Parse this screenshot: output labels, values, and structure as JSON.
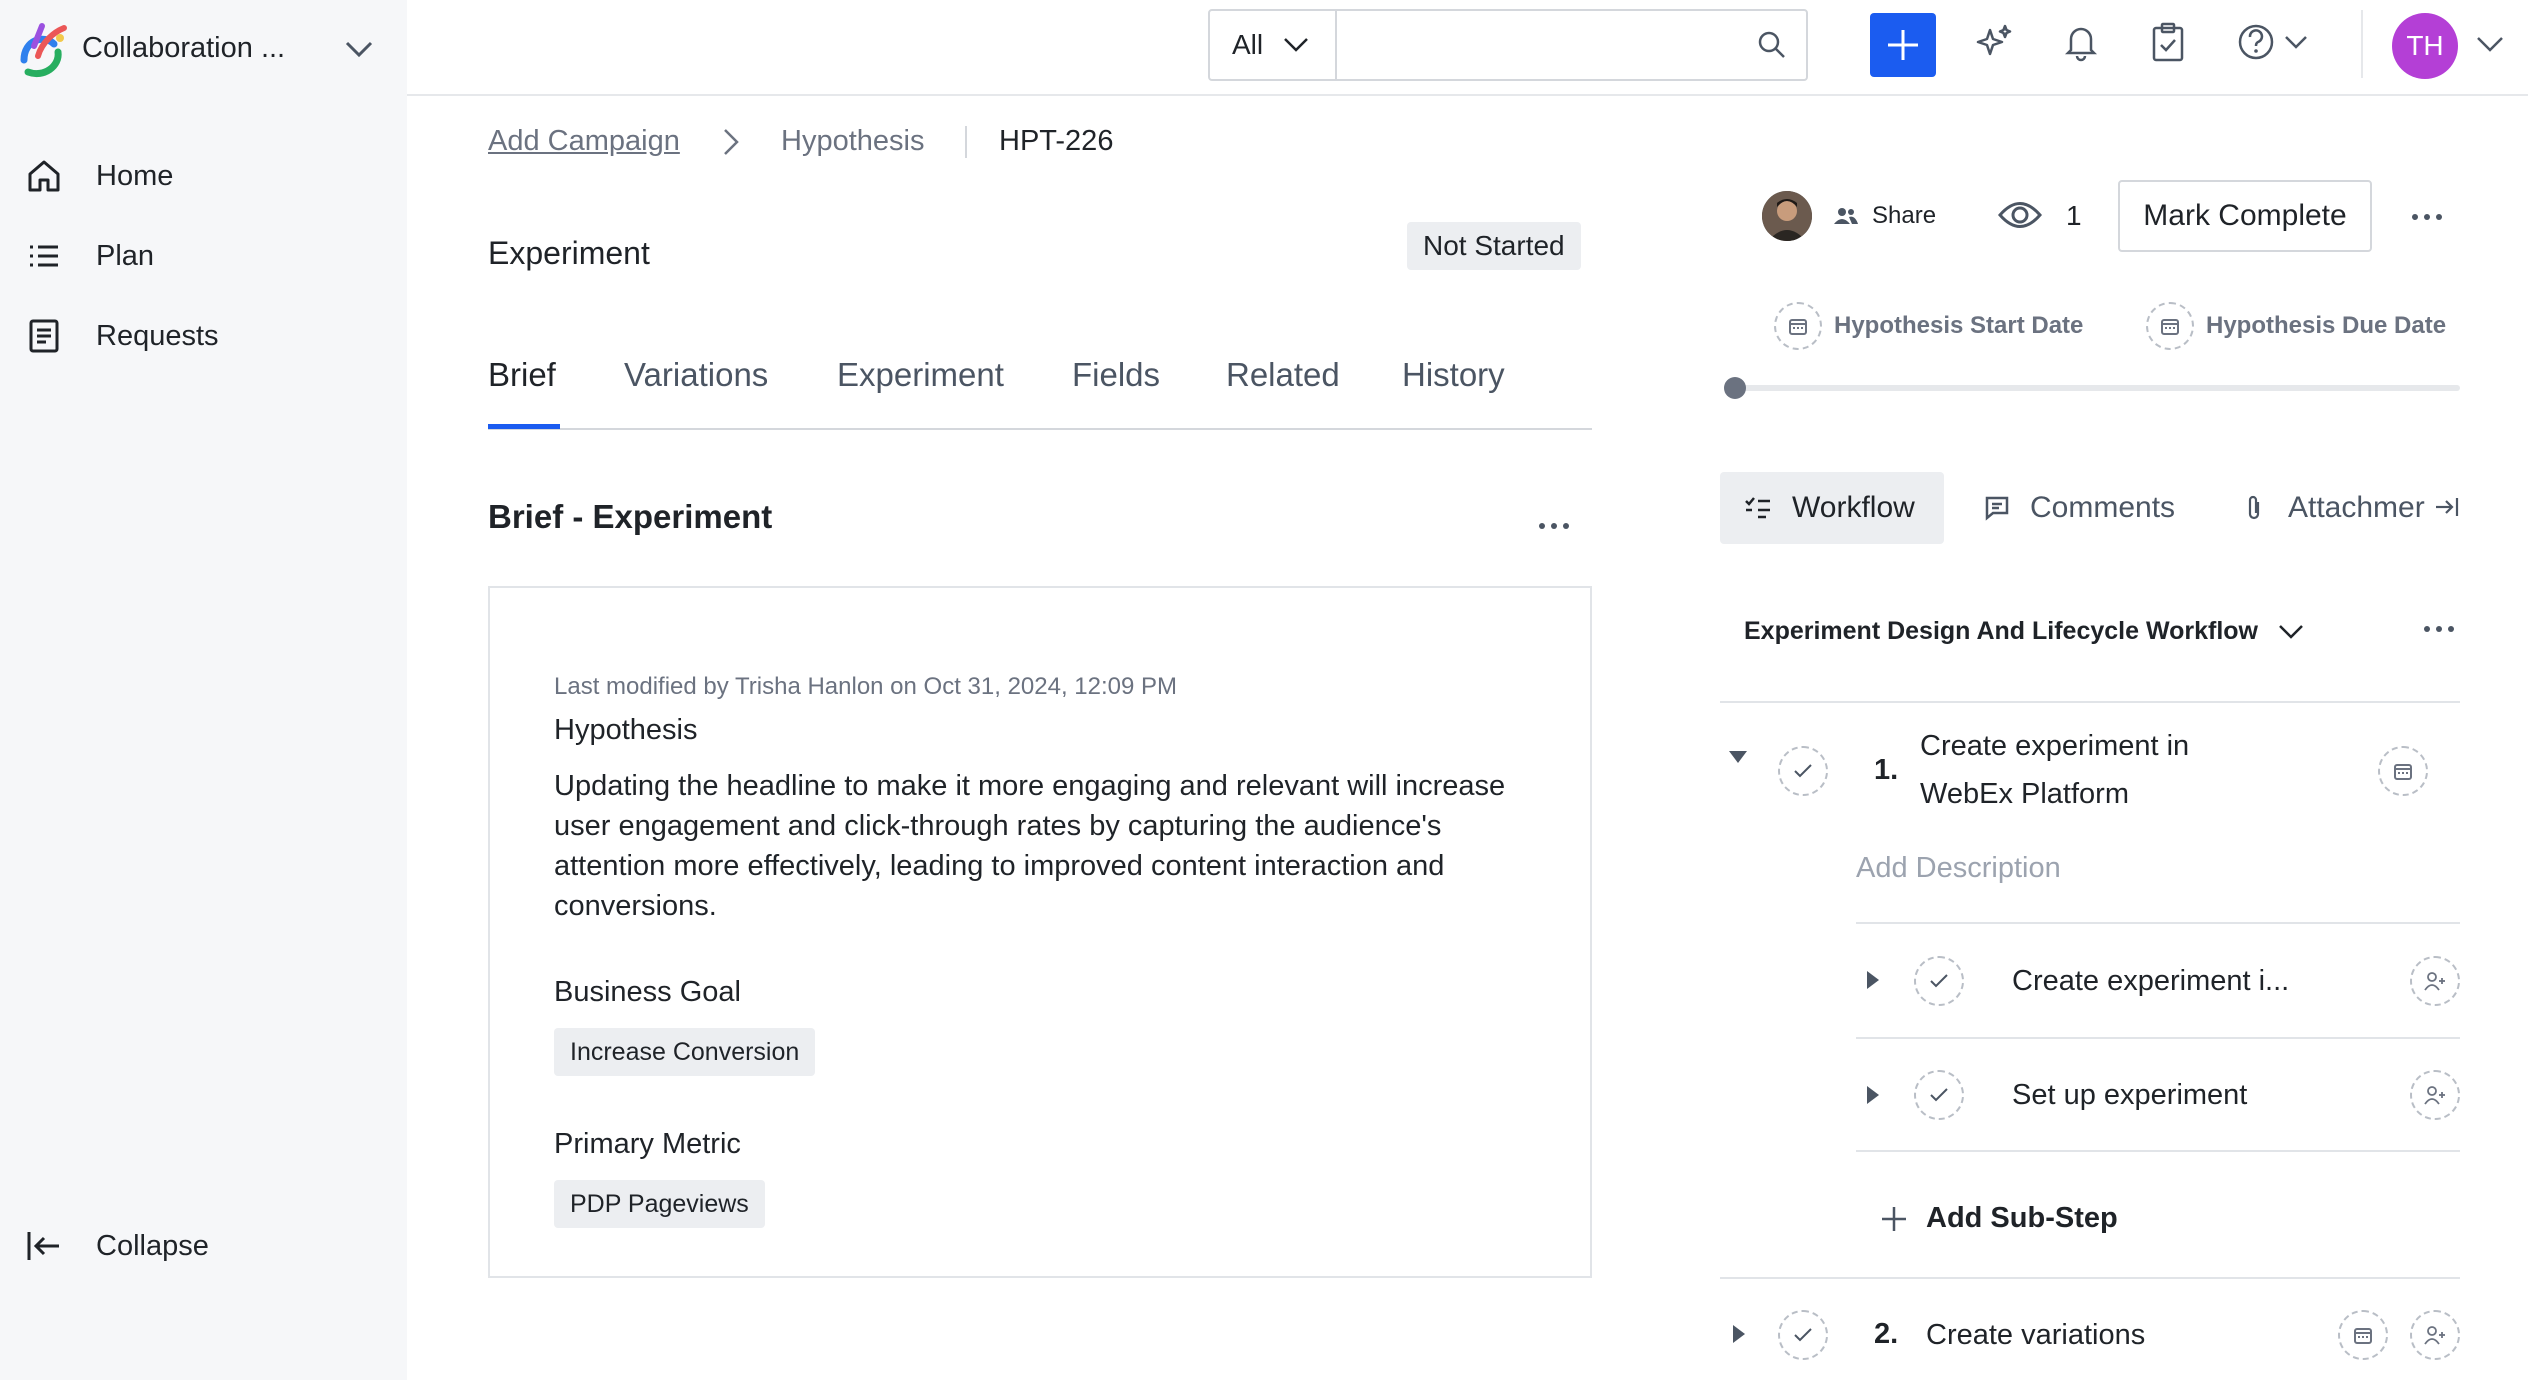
{
  "sidebar": {
    "workspace_name": "Collaboration ...",
    "items": [
      {
        "label": "Home",
        "icon": "home-icon"
      },
      {
        "label": "Plan",
        "icon": "list-icon"
      },
      {
        "label": "Requests",
        "icon": "document-icon"
      }
    ],
    "collapse_label": "Collapse"
  },
  "topbar": {
    "search_scope": "All",
    "search_placeholder": "",
    "user_initials": "TH",
    "accent_color": "#1b5cf0",
    "avatar_color": "#b43fd6"
  },
  "breadcrumb": {
    "parent": "Add Campaign",
    "type": "Hypothesis",
    "id": "HPT-226"
  },
  "main": {
    "title": "Experiment",
    "status": "Not Started",
    "tabs": [
      "Brief",
      "Variations",
      "Experiment",
      "Fields",
      "Related",
      "History"
    ],
    "active_tab": "Brief",
    "section_title": "Brief - Experiment",
    "card": {
      "last_modified": "Last modified by Trisha Hanlon on Oct 31, 2024, 12:09 PM",
      "hypothesis_label": "Hypothesis",
      "hypothesis_text": "Updating the headline to make it more engaging and relevant will increase user engagement and click-through rates by capturing the audience's attention more effectively, leading to improved content interaction and conversions.",
      "business_goal_label": "Business Goal",
      "business_goal_value": "Increase Conversion",
      "primary_metric_label": "Primary Metric",
      "primary_metric_value": "PDP Pageviews"
    }
  },
  "right_panel": {
    "share_label": "Share",
    "watchers_count": "1",
    "mark_complete_label": "Mark Complete",
    "start_date_label": "Hypothesis Start Date",
    "due_date_label": "Hypothesis Due Date",
    "tabs": [
      "Workflow",
      "Comments",
      "Attachmer"
    ],
    "workflow_name": "Experiment Design And Lifecycle Workflow",
    "steps": [
      {
        "number": "1.",
        "title_line1": "Create experiment in",
        "title_line2": "WebEx Platform",
        "description_placeholder": "Add Description",
        "sub_steps": [
          "Create experiment i...",
          "Set up experiment"
        ],
        "add_sub_step_label": "Add Sub-Step"
      },
      {
        "number": "2.",
        "title": "Create variations"
      }
    ]
  }
}
